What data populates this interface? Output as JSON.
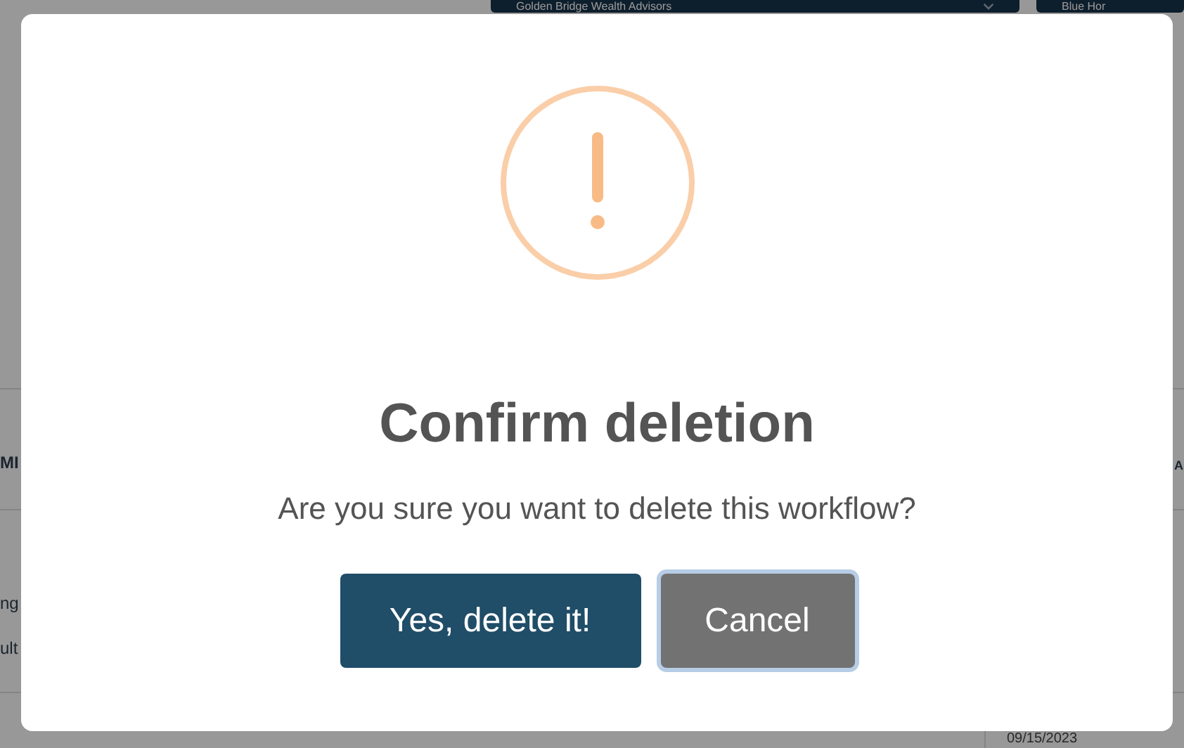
{
  "background": {
    "filters": [
      {
        "label": "Golden Bridge Wealth Advisors",
        "kind": "dropdown"
      },
      {
        "label": "Blue Hor",
        "kind": "plain"
      }
    ],
    "column_1": "MI",
    "column_2": "A",
    "row_texts": [
      "ng",
      "ult"
    ],
    "date": "09/15/2023"
  },
  "dialog": {
    "title": "Confirm deletion",
    "message": "Are you sure you want to delete this workflow?",
    "buttons": [
      {
        "label": "Yes, delete it!",
        "kind": "confirm",
        "focused": false
      },
      {
        "label": "Cancel",
        "kind": "cancel",
        "focused": true
      }
    ]
  }
}
